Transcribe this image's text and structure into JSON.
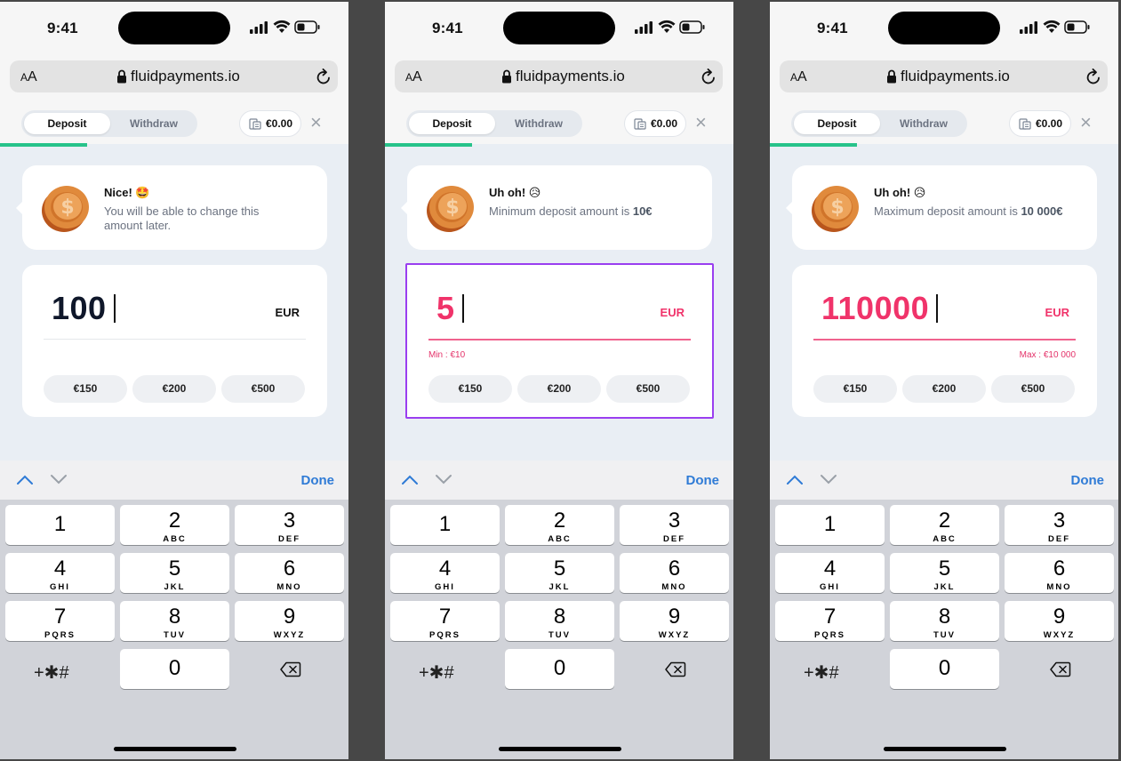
{
  "phones": [
    {
      "status_time": "9:41",
      "url": "fluidpayments.io",
      "aa_label": "AA",
      "tabs": {
        "deposit": "Deposit",
        "withdraw": "Withdraw"
      },
      "balance": "€0.00",
      "message": {
        "title": "Nice! 🤩",
        "body_plain": "You will be able to change this amount later.",
        "body_bold": ""
      },
      "amount": "100",
      "amount_state": "normal",
      "currency": "EUR",
      "hint": "",
      "chips": [
        "€150",
        "€200",
        "€500"
      ],
      "done_label": "Done"
    },
    {
      "status_time": "9:41",
      "url": "fluidpayments.io",
      "aa_label": "AA",
      "tabs": {
        "deposit": "Deposit",
        "withdraw": "Withdraw"
      },
      "balance": "€0.00",
      "message": {
        "title": "Uh oh! 😥",
        "body_plain": "Minimum deposit amount is ",
        "body_bold": "10€"
      },
      "amount": "5",
      "amount_state": "error",
      "currency": "EUR",
      "hint": "Min : €10",
      "chips": [
        "€150",
        "€200",
        "€500"
      ],
      "done_label": "Done"
    },
    {
      "status_time": "9:41",
      "url": "fluidpayments.io",
      "aa_label": "AA",
      "tabs": {
        "deposit": "Deposit",
        "withdraw": "Withdraw"
      },
      "balance": "€0.00",
      "message": {
        "title": "Uh oh! 😥",
        "body_plain": "Maximum deposit amount is ",
        "body_bold": "10 000€"
      },
      "amount": "110000",
      "amount_state": "error",
      "currency": "EUR",
      "hint": "Max : €10 000",
      "chips": [
        "€150",
        "€200",
        "€500"
      ],
      "done_label": "Done"
    }
  ],
  "keypad": [
    {
      "num": "1",
      "letters": ""
    },
    {
      "num": "2",
      "letters": "ABC"
    },
    {
      "num": "3",
      "letters": "DEF"
    },
    {
      "num": "4",
      "letters": "GHI"
    },
    {
      "num": "5",
      "letters": "JKL"
    },
    {
      "num": "6",
      "letters": "MNO"
    },
    {
      "num": "7",
      "letters": "PQRS"
    },
    {
      "num": "8",
      "letters": "TUV"
    },
    {
      "num": "9",
      "letters": "WXYZ"
    },
    {
      "num": "0",
      "letters": ""
    }
  ],
  "keypad_symbols": "+✱#",
  "colors": {
    "error": "#f0336a",
    "accent": "#2f7bd6",
    "progress": "#27c38a",
    "selection": "#9a3ef0"
  }
}
